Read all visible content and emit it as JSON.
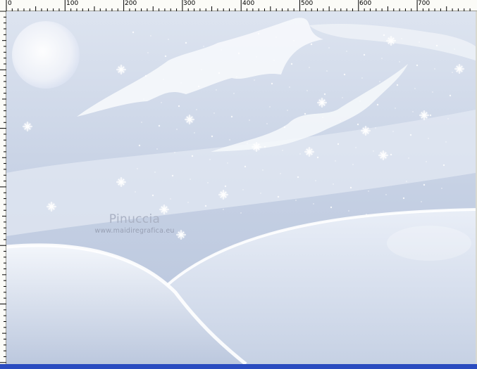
{
  "ruler": {
    "labels": [
      "0",
      "100",
      "200",
      "300",
      "400",
      "500",
      "600",
      "700"
    ]
  },
  "watermark": {
    "title": "Pinuccia",
    "subtitle": "www.maidiregrafica.eu"
  },
  "colors": {
    "sky": "#c3cfe3",
    "snow": "#ffffff",
    "accent_bar": "#2a4cc0",
    "ruler_bg": "#fbfbf7"
  }
}
